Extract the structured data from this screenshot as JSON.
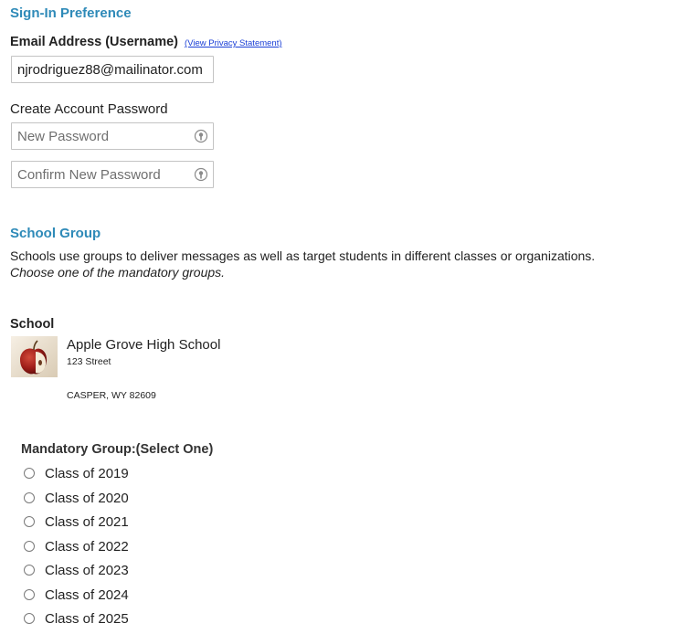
{
  "signin": {
    "title": "Sign-In Preference",
    "email_label": "Email Address (Username)",
    "privacy_link": "(View Privacy Statement)",
    "email_value": "njrodriguez88@mailinator.com",
    "password_label": "Create Account Password",
    "new_password_placeholder": "New Password",
    "confirm_password_placeholder": "Confirm New Password",
    "password_icon": "key-icon"
  },
  "school_group": {
    "title": "School Group",
    "description": "Schools use groups to deliver messages as well as target students in different classes or organizations.",
    "instruction": "Choose one of the mandatory groups."
  },
  "school": {
    "label": "School",
    "name": "Apple Grove High School",
    "street": "123 Street",
    "city_state_zip": "CASPER, WY 82609",
    "image_icon": "apple-icon"
  },
  "mandatory_group": {
    "heading": "Mandatory Group:(Select One)",
    "options": [
      {
        "label": "Class of 2019",
        "selected": false
      },
      {
        "label": "Class of 2020",
        "selected": false
      },
      {
        "label": "Class of 2021",
        "selected": false
      },
      {
        "label": "Class of 2022",
        "selected": false
      },
      {
        "label": "Class of 2023",
        "selected": false
      },
      {
        "label": "Class of 2024",
        "selected": false
      },
      {
        "label": "Class of 2025",
        "selected": false
      }
    ]
  },
  "colors": {
    "section_title": "#2e8ab8",
    "link": "#1a3fd6"
  }
}
